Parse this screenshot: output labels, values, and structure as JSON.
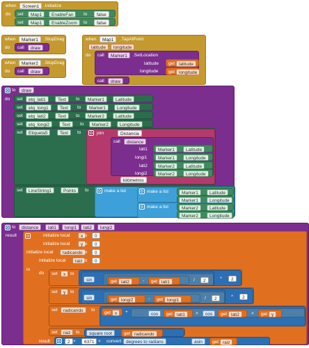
{
  "blocks": {
    "screen_init": {
      "when": "when",
      "component": "Screen1",
      "event": ".Initialize",
      "do": "do",
      "rows": [
        {
          "set": "set",
          "comp": "Map1",
          "prop": "EnableFan",
          "to": "to",
          "value": "false"
        },
        {
          "set": "set",
          "comp": "Map1",
          "prop": "EnableZoom",
          "to": "to",
          "value": "false"
        }
      ]
    },
    "marker1_drag": {
      "when": "when",
      "component": "Marker1",
      "event": ".StopDrag",
      "do": "do",
      "call": "call",
      "proc": "draw"
    },
    "marker2_drag": {
      "when": "when",
      "component": "Marker2",
      "event": ".StopDrag",
      "do": "do",
      "call": "call",
      "proc": "draw"
    },
    "map_tap": {
      "when": "when",
      "component": "Map1",
      "event": ".TapAtPoint",
      "params": [
        "latitude",
        "longitude"
      ],
      "do": "do",
      "call": "call",
      "target": "Marker1",
      "method": ".SetLocation",
      "arg1_label": "latitude",
      "arg2_label": "longitude",
      "get": "get",
      "arg1_var": "latitude",
      "arg2_var": "longitude",
      "call2": "call",
      "proc": "draw"
    },
    "draw_proc": {
      "to": "to",
      "name": "draw",
      "do": "do",
      "rows": [
        {
          "set": "set",
          "comp": "etq_lati1",
          "prop": "Text",
          "to": "to",
          "src": "Marker1",
          "field": "Latitude"
        },
        {
          "set": "set",
          "comp": "etq_long1",
          "prop": "Text",
          "to": "to",
          "src": "Marker1",
          "field": "Longitude"
        },
        {
          "set": "set",
          "comp": "etq_lati2",
          "prop": "Text",
          "to": "to",
          "src": "Marker2",
          "field": "Latitude"
        },
        {
          "set": "set",
          "comp": "etq_longi2",
          "prop": "Text",
          "to": "to",
          "src": "Marker2",
          "field": "Longitude"
        }
      ],
      "etiqueta": {
        "set": "set",
        "comp": "Etiqueta5",
        "prop": "Text",
        "to": "to",
        "join": "join",
        "str1": "Distancia",
        "call": "call",
        "fn": "distance",
        "kilometros": "kilómetros",
        "args": [
          {
            "name": "lati1",
            "src": "Marker1",
            "field": "Latitude"
          },
          {
            "name": "longi1",
            "src": "Marker1",
            "field": "Longitude"
          },
          {
            "name": "lati2",
            "src": "Marker2",
            "field": "Latitude"
          },
          {
            "name": "longi2",
            "src": "Marker2",
            "field": "Longitude"
          }
        ]
      },
      "linestring": {
        "set": "set",
        "comp": "LineString1",
        "prop": "Points",
        "to": "to",
        "make_list": "make a list",
        "points": [
          {
            "src": "Marker1",
            "field": "Latitude"
          },
          {
            "src": "Marker1",
            "field": "Longitude"
          },
          {
            "src": "Marker2",
            "field": "Latitude"
          },
          {
            "src": "Marker2",
            "field": "Longitude"
          }
        ]
      }
    },
    "distance_proc": {
      "to": "to",
      "name": "distance",
      "params": [
        "lati1",
        "longi1",
        "lati2",
        "longi2"
      ],
      "result": "result",
      "locals": [
        {
          "label": "initialize local",
          "name": "x",
          "to": "to",
          "value": "0"
        },
        {
          "label": "initialize local",
          "name": "y",
          "to": "to",
          "value": "0"
        },
        {
          "label": "initialize local",
          "name": "radicando",
          "to": "to",
          "value": "0"
        },
        {
          "label": "initialize local",
          "name": "raiz",
          "to": "to",
          "value": "0"
        }
      ],
      "in": "in",
      "do": "do",
      "set_x": {
        "set": "set",
        "var": "x",
        "to": "to",
        "fn": "sin",
        "get": "get",
        "a": "lati2",
        "b": "lati1",
        "div": "/",
        "two": "2",
        "pow": "^",
        "exp": "2"
      },
      "set_y": {
        "set": "set",
        "var": "y",
        "to": "to",
        "fn": "sin",
        "get": "get",
        "a": "longi2",
        "b": "longi1",
        "div": "/",
        "two": "2",
        "pow": "^",
        "exp": "2"
      },
      "set_rad": {
        "set": "set",
        "var": "radicando",
        "to": "to",
        "get": "get",
        "x": "x",
        "plus": "+",
        "times": "×",
        "cos": "cos",
        "a": "lati1",
        "b": "lati2",
        "y": "y"
      },
      "set_raiz": {
        "set": "set",
        "var": "raiz",
        "to": "to",
        "fn": "square root",
        "get": "get",
        "arg": "radicando"
      },
      "result_row": {
        "label": "result",
        "times": "×",
        "two": "2",
        "radius": "6371",
        "convert": "convert",
        "mode": "degrees to radians",
        "asin": "asin",
        "get": "get",
        "arg": "raiz"
      }
    }
  }
}
